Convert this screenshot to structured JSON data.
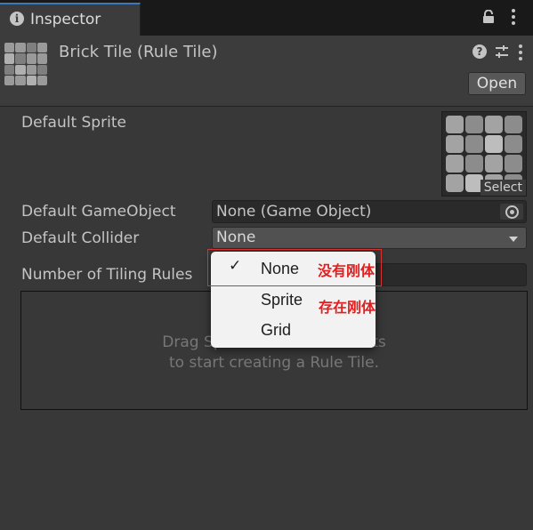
{
  "window": {
    "tab_label": "Inspector",
    "tab_icon": "info-icon"
  },
  "header": {
    "title": "Brick Tile (Rule Tile)",
    "open_label": "Open"
  },
  "fields": {
    "default_sprite_label": "Default Sprite",
    "sprite_select_label": "Select",
    "default_gameobject_label": "Default GameObject",
    "default_gameobject_value": "None (Game Object)",
    "default_collider_label": "Default Collider",
    "default_collider_value": "None",
    "tiling_rules_label": "Number of Tiling Rules"
  },
  "rules_area": {
    "hint_line1": "Drag Sprit",
    "hint_line1_end": "sets",
    "hint_line2": "to start creating a Rule Tile."
  },
  "dropdown_menu": {
    "options": [
      {
        "label": "None",
        "checked": true,
        "check_mark": "✓"
      },
      {
        "label": "Sprite",
        "checked": false
      },
      {
        "label": "Grid",
        "checked": false
      }
    ]
  },
  "annotations": {
    "note_none": "没有刚体",
    "note_sprite": "存在刚体",
    "color": "#e02020"
  },
  "colors": {
    "background": "#383838",
    "tab_accent": "#3a79bb",
    "popup_bg": "#f2f2f2"
  }
}
